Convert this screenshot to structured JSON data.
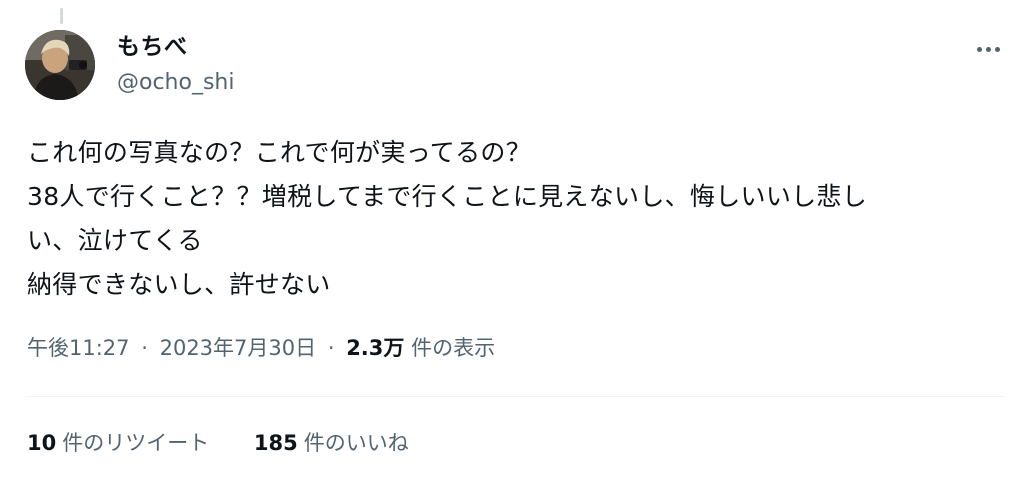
{
  "tweet": {
    "author": {
      "display_name": "もちべ",
      "handle": "@ocho_shi",
      "avatar_icon": "user-avatar-photo"
    },
    "more_icon": "more-dots-icon",
    "text_lines": [
      "これ何の写真なの？これで何が実ってるの？",
      "38人で行くこと？？増税してまで行くことに見えないし、悔しいいし悲し",
      "い、泣けてくる",
      "納得できないし、許せない"
    ],
    "meta": {
      "time": "午後11:27",
      "separator": "·",
      "date": "2023年7月30日",
      "views_count": "2.3万",
      "views_label": "件の表示"
    },
    "stats": {
      "retweets_count": "10",
      "retweets_label": "件のリツイート",
      "likes_count": "185",
      "likes_label": "件のいいね"
    }
  },
  "colors": {
    "text_primary": "#0f1419",
    "text_secondary": "#536471",
    "divider": "#eff3f4",
    "thread_line": "#cfd9de"
  }
}
